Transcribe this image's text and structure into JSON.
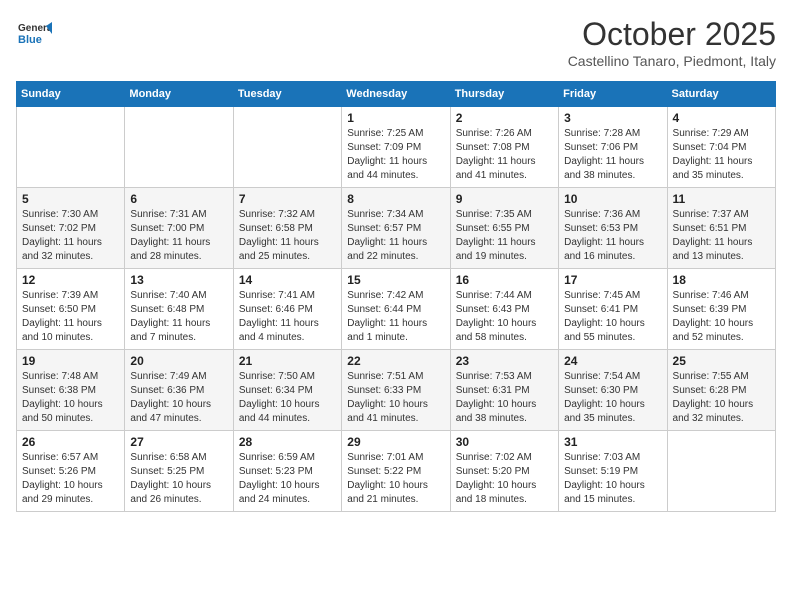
{
  "header": {
    "logo_line1": "General",
    "logo_line2": "Blue",
    "month": "October 2025",
    "location": "Castellino Tanaro, Piedmont, Italy"
  },
  "weekdays": [
    "Sunday",
    "Monday",
    "Tuesday",
    "Wednesday",
    "Thursday",
    "Friday",
    "Saturday"
  ],
  "weeks": [
    [
      {
        "day": "",
        "info": ""
      },
      {
        "day": "",
        "info": ""
      },
      {
        "day": "",
        "info": ""
      },
      {
        "day": "1",
        "info": "Sunrise: 7:25 AM\nSunset: 7:09 PM\nDaylight: 11 hours\nand 44 minutes."
      },
      {
        "day": "2",
        "info": "Sunrise: 7:26 AM\nSunset: 7:08 PM\nDaylight: 11 hours\nand 41 minutes."
      },
      {
        "day": "3",
        "info": "Sunrise: 7:28 AM\nSunset: 7:06 PM\nDaylight: 11 hours\nand 38 minutes."
      },
      {
        "day": "4",
        "info": "Sunrise: 7:29 AM\nSunset: 7:04 PM\nDaylight: 11 hours\nand 35 minutes."
      }
    ],
    [
      {
        "day": "5",
        "info": "Sunrise: 7:30 AM\nSunset: 7:02 PM\nDaylight: 11 hours\nand 32 minutes."
      },
      {
        "day": "6",
        "info": "Sunrise: 7:31 AM\nSunset: 7:00 PM\nDaylight: 11 hours\nand 28 minutes."
      },
      {
        "day": "7",
        "info": "Sunrise: 7:32 AM\nSunset: 6:58 PM\nDaylight: 11 hours\nand 25 minutes."
      },
      {
        "day": "8",
        "info": "Sunrise: 7:34 AM\nSunset: 6:57 PM\nDaylight: 11 hours\nand 22 minutes."
      },
      {
        "day": "9",
        "info": "Sunrise: 7:35 AM\nSunset: 6:55 PM\nDaylight: 11 hours\nand 19 minutes."
      },
      {
        "day": "10",
        "info": "Sunrise: 7:36 AM\nSunset: 6:53 PM\nDaylight: 11 hours\nand 16 minutes."
      },
      {
        "day": "11",
        "info": "Sunrise: 7:37 AM\nSunset: 6:51 PM\nDaylight: 11 hours\nand 13 minutes."
      }
    ],
    [
      {
        "day": "12",
        "info": "Sunrise: 7:39 AM\nSunset: 6:50 PM\nDaylight: 11 hours\nand 10 minutes."
      },
      {
        "day": "13",
        "info": "Sunrise: 7:40 AM\nSunset: 6:48 PM\nDaylight: 11 hours\nand 7 minutes."
      },
      {
        "day": "14",
        "info": "Sunrise: 7:41 AM\nSunset: 6:46 PM\nDaylight: 11 hours\nand 4 minutes."
      },
      {
        "day": "15",
        "info": "Sunrise: 7:42 AM\nSunset: 6:44 PM\nDaylight: 11 hours\nand 1 minute."
      },
      {
        "day": "16",
        "info": "Sunrise: 7:44 AM\nSunset: 6:43 PM\nDaylight: 10 hours\nand 58 minutes."
      },
      {
        "day": "17",
        "info": "Sunrise: 7:45 AM\nSunset: 6:41 PM\nDaylight: 10 hours\nand 55 minutes."
      },
      {
        "day": "18",
        "info": "Sunrise: 7:46 AM\nSunset: 6:39 PM\nDaylight: 10 hours\nand 52 minutes."
      }
    ],
    [
      {
        "day": "19",
        "info": "Sunrise: 7:48 AM\nSunset: 6:38 PM\nDaylight: 10 hours\nand 50 minutes."
      },
      {
        "day": "20",
        "info": "Sunrise: 7:49 AM\nSunset: 6:36 PM\nDaylight: 10 hours\nand 47 minutes."
      },
      {
        "day": "21",
        "info": "Sunrise: 7:50 AM\nSunset: 6:34 PM\nDaylight: 10 hours\nand 44 minutes."
      },
      {
        "day": "22",
        "info": "Sunrise: 7:51 AM\nSunset: 6:33 PM\nDaylight: 10 hours\nand 41 minutes."
      },
      {
        "day": "23",
        "info": "Sunrise: 7:53 AM\nSunset: 6:31 PM\nDaylight: 10 hours\nand 38 minutes."
      },
      {
        "day": "24",
        "info": "Sunrise: 7:54 AM\nSunset: 6:30 PM\nDaylight: 10 hours\nand 35 minutes."
      },
      {
        "day": "25",
        "info": "Sunrise: 7:55 AM\nSunset: 6:28 PM\nDaylight: 10 hours\nand 32 minutes."
      }
    ],
    [
      {
        "day": "26",
        "info": "Sunrise: 6:57 AM\nSunset: 5:26 PM\nDaylight: 10 hours\nand 29 minutes."
      },
      {
        "day": "27",
        "info": "Sunrise: 6:58 AM\nSunset: 5:25 PM\nDaylight: 10 hours\nand 26 minutes."
      },
      {
        "day": "28",
        "info": "Sunrise: 6:59 AM\nSunset: 5:23 PM\nDaylight: 10 hours\nand 24 minutes."
      },
      {
        "day": "29",
        "info": "Sunrise: 7:01 AM\nSunset: 5:22 PM\nDaylight: 10 hours\nand 21 minutes."
      },
      {
        "day": "30",
        "info": "Sunrise: 7:02 AM\nSunset: 5:20 PM\nDaylight: 10 hours\nand 18 minutes."
      },
      {
        "day": "31",
        "info": "Sunrise: 7:03 AM\nSunset: 5:19 PM\nDaylight: 10 hours\nand 15 minutes."
      },
      {
        "day": "",
        "info": ""
      }
    ]
  ]
}
